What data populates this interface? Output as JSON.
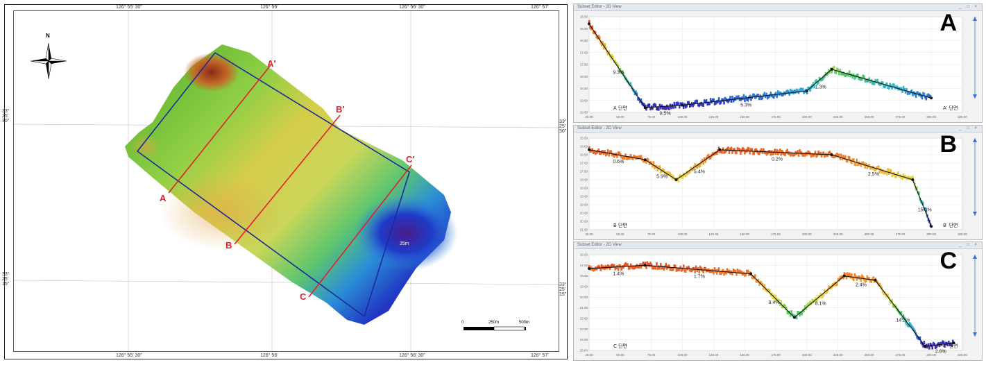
{
  "map": {
    "top_coords": [
      "126° 55' 30\"",
      "126° 56'",
      "126° 56' 30\"",
      "126° 57'"
    ],
    "bottom_coords": [
      "126° 55' 30\"",
      "126° 56'",
      "126° 56' 30\"",
      "126° 57'"
    ],
    "left_coords": [
      "33° 25' 30\"",
      "33° 25' 15\""
    ],
    "right_coords": [
      "33° 25' 30\"",
      "33° 25' 15\""
    ],
    "north_label": "N",
    "depth_label": "25m",
    "scale_labels": [
      "0",
      "250m",
      "500m"
    ],
    "line_labels": {
      "A": "A",
      "A_prime": "A′",
      "B": "B",
      "B_prime": "B′",
      "C": "C",
      "C_prime": "C′"
    }
  },
  "profiles": [
    {
      "letter": "A",
      "window_title": "Subset Editor - 2D View",
      "start_label": "A 단면",
      "end_label": "A′ 단면",
      "slopes": [
        "9.3%",
        "0.5%",
        "5.3%",
        "1.3%"
      ],
      "x_ticks": [
        "25.00",
        "50.00",
        "75.00",
        "100.00",
        "125.00",
        "150.00",
        "175.00",
        "200.00",
        "225.00",
        "250.00",
        "275.00",
        "300.00",
        "325.00"
      ],
      "y_ticks": [
        "15.50",
        "16.00",
        "16.50",
        "17.00",
        "17.50",
        "18.00",
        "18.50",
        "19.00",
        "19.50"
      ],
      "vertices": [
        [
          25,
          15.8
        ],
        [
          70,
          19.3
        ],
        [
          100,
          19.2
        ],
        [
          200,
          18.6
        ],
        [
          220,
          17.7
        ],
        [
          300,
          18.9
        ]
      ]
    },
    {
      "letter": "B",
      "window_title": "Subset Editor - 2D View",
      "start_label": "B 단면",
      "end_label": "B′ 단면",
      "slopes": [
        "0.6%",
        "5.9%",
        "5.4%",
        "0.2%",
        "2.5%",
        "15.0%"
      ],
      "x_ticks": [
        "25.00",
        "50.00",
        "75.00",
        "100.00",
        "125.00",
        "150.00",
        "175.00",
        "200.00",
        "225.00",
        "250.00",
        "275.00",
        "300.00",
        "325.00"
      ],
      "y_ticks": [
        "15.50",
        "16.00",
        "16.50",
        "17.00",
        "17.50",
        "18.00",
        "18.50",
        "19.00",
        "19.50",
        "20.00",
        "20.50",
        "21.00"
      ],
      "vertices": [
        [
          25,
          16.2
        ],
        [
          70,
          16.8
        ],
        [
          95,
          18.0
        ],
        [
          130,
          16.2
        ],
        [
          220,
          16.5
        ],
        [
          285,
          18.0
        ],
        [
          300,
          20.8
        ]
      ]
    },
    {
      "letter": "C",
      "window_title": "Subset Editor - 2D View",
      "start_label": "C 단면",
      "end_label": "C′ 단면",
      "slopes": [
        "1.4%",
        "1.7%",
        "9.4%",
        "8.1%",
        "2.4%",
        "14.2%",
        "2.6%"
      ],
      "x_ticks": [
        "25.00",
        "50.00",
        "75.00",
        "100.00",
        "125.00",
        "150.00",
        "175.00",
        "200.00",
        "225.00",
        "250.00",
        "275.00",
        "300.00",
        "325.00"
      ],
      "y_ticks": [
        "16.00",
        "17.00",
        "18.00",
        "19.00",
        "20.00",
        "21.00",
        "22.00",
        "23.00",
        "24.00",
        "25.00"
      ],
      "vertices": [
        [
          25,
          17.3
        ],
        [
          70,
          17.0
        ],
        [
          155,
          17.8
        ],
        [
          190,
          21.9
        ],
        [
          230,
          18.0
        ],
        [
          255,
          18.4
        ],
        [
          295,
          24.6
        ],
        [
          318,
          24.3
        ]
      ]
    }
  ],
  "colors": {
    "section_line": "#e0202a",
    "box_line": "#1a2a9a",
    "profile_line": "#111111"
  }
}
